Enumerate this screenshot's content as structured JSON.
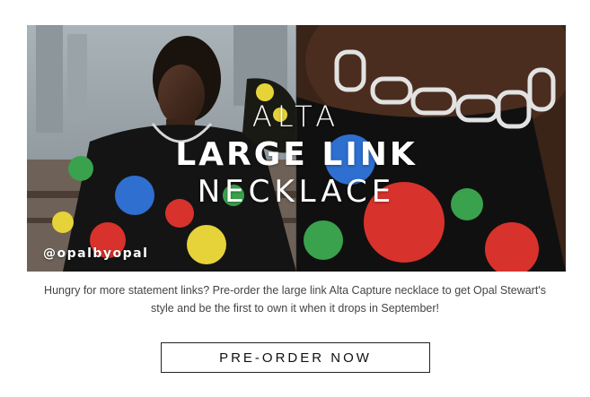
{
  "hero": {
    "title_line1": "ALTA",
    "title_line2": "LARGE LINK",
    "title_line3": "NECKLACE",
    "handle": "@opalbyopal"
  },
  "description": "Hungry for more statement links? Pre-order the large link Alta Capture necklace to get Opal Stewart's style and be the first to own it when it drops in September!",
  "cta": {
    "label": "PRE-ORDER NOW"
  },
  "colors": {
    "text": "#444444",
    "button_border": "#222222",
    "overlay_text": "#ffffff"
  }
}
